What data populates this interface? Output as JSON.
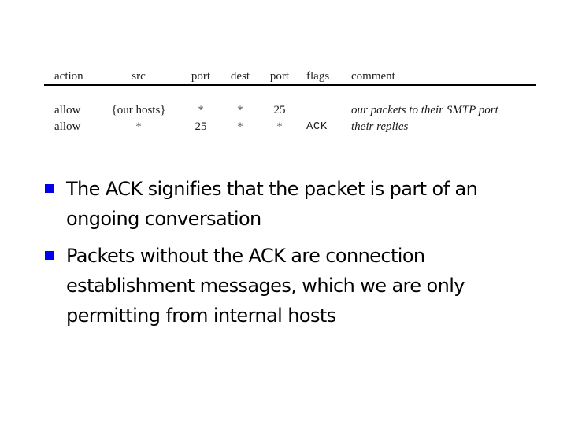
{
  "table": {
    "headers": {
      "action": "action",
      "src": "src",
      "src_port": "port",
      "dest": "dest",
      "dest_port": "port",
      "flags": "flags",
      "comment": "comment"
    },
    "rows": [
      {
        "action": "allow",
        "src": "{our hosts}",
        "src_port": "*",
        "dest": "*",
        "dest_port": "25",
        "flags": "",
        "comment": "our packets to their SMTP port"
      },
      {
        "action": "allow",
        "src": "*",
        "src_port": "25",
        "dest": "*",
        "dest_port": "*",
        "flags": "ACK",
        "comment": "their replies"
      }
    ]
  },
  "bullets": [
    {
      "icon": "square-bullet-icon",
      "lines": [
        "The ACK signifies that the packet is part of an",
        "ongoing conversation"
      ]
    },
    {
      "icon": "square-bullet-icon",
      "lines": [
        "Packets without the ACK are connection",
        "establishment messages, which we are only",
        "permitting from internal hosts"
      ]
    }
  ],
  "colors": {
    "bullet": "#0000ee",
    "text": "#000000",
    "background": "#ffffff"
  }
}
